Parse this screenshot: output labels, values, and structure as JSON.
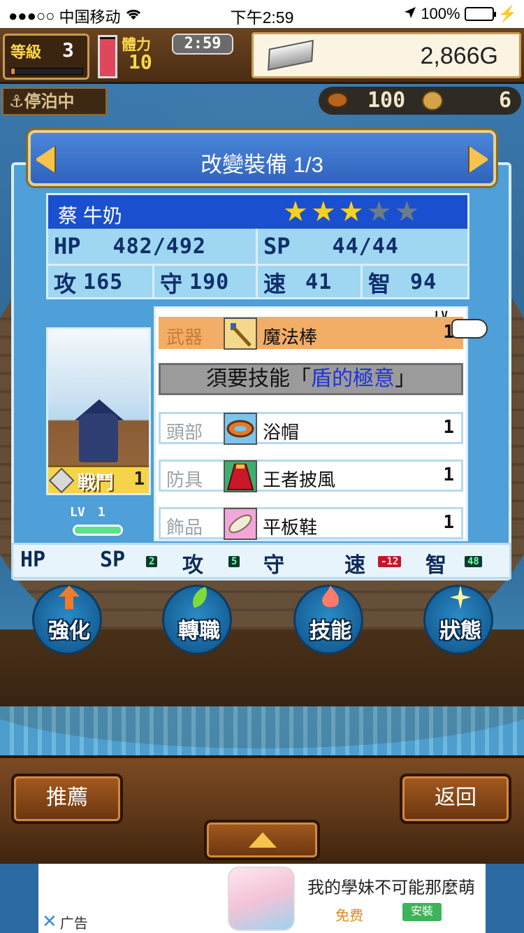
{
  "status_bar": {
    "signal": "●●●○○",
    "carrier": "中国移动",
    "time": "下午2:59",
    "battery": "100%"
  },
  "hud": {
    "level_label": "等級",
    "level": "3",
    "level_progress": 0.05,
    "stamina_label": "體力",
    "stamina": "10",
    "stamina_fraction": 0.95,
    "timer": "2:59",
    "gold": "2,866G",
    "status": "停泊中",
    "food": "100",
    "coins": "6"
  },
  "panel": {
    "title": "改變裝備 1/3",
    "character": {
      "name": "蔡 牛奶",
      "stars_filled": 3,
      "stars_total": 5,
      "hp_label": "HP",
      "hp": "482/492",
      "sp_label": "SP",
      "sp": "44/44",
      "atk_label": "攻",
      "atk": "165",
      "def_label": "守",
      "def": "190",
      "spd_label": "速",
      "spd": "41",
      "int_label": "智",
      "int": "94",
      "job": "戦鬥",
      "job_level": "1",
      "lv_label": "LV",
      "level": "1"
    },
    "lv_header": "LV",
    "equipment": [
      {
        "category": "武器",
        "item": "魔法棒",
        "level": "1",
        "selected": true
      },
      {
        "category": "頭部",
        "item": "浴帽",
        "level": "1",
        "selected": false
      },
      {
        "category": "防具",
        "item": "王者披風",
        "level": "1",
        "selected": false
      },
      {
        "category": "飾品",
        "item": "平板鞋",
        "level": "1",
        "selected": false
      }
    ],
    "requirement": {
      "prefix": "須要技能「",
      "skill": "盾的極意",
      "suffix": "」"
    },
    "bonus": {
      "hp_label": "HP",
      "sp_label": "SP",
      "sp": "2",
      "atk_label": "攻",
      "atk": "5",
      "def_label": "守",
      "spd_label": "速",
      "spd": "-12",
      "int_label": "智",
      "int": "48"
    }
  },
  "actions": [
    {
      "label": "強化",
      "icon": "arrow-up-icon",
      "color": "#f07b2a"
    },
    {
      "label": "轉職",
      "icon": "leaf-icon",
      "color": "#7ddc3a"
    },
    {
      "label": "技能",
      "icon": "flame-icon",
      "color": "#ff7a6a"
    },
    {
      "label": "狀態",
      "icon": "sparkle-icon",
      "color": "#fff5a0"
    }
  ],
  "bottom": {
    "recommend": "推薦",
    "back": "返回"
  },
  "ad": {
    "title": "我的學妹不可能那麼萌",
    "free": "免费",
    "install": "安裝",
    "ad_label": "广告"
  }
}
